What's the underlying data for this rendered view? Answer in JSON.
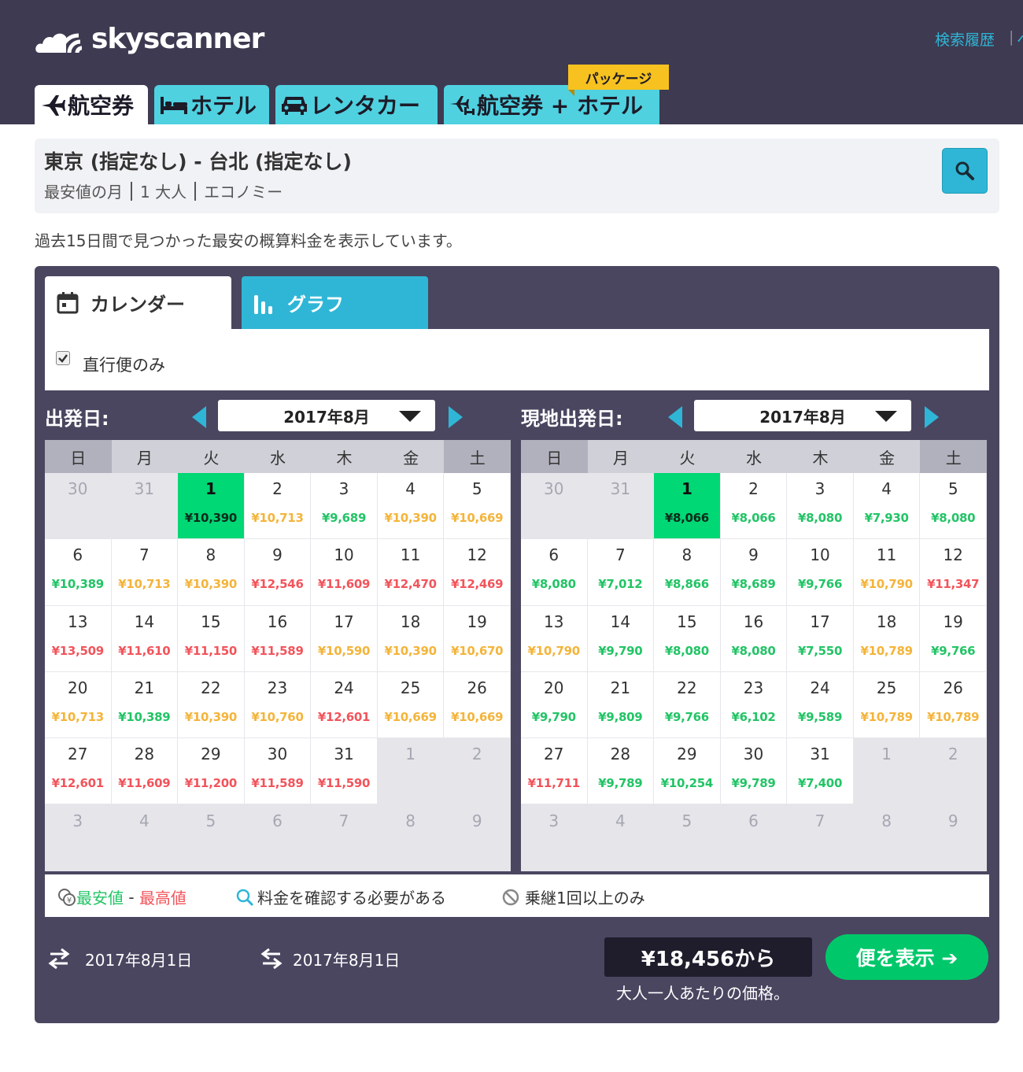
{
  "header": {
    "logo_text": "skyscanner",
    "history_link": "検索履歴",
    "history_sep": "|",
    "history_more": "ヘ",
    "tabs": [
      {
        "label": "航空券",
        "icon": "plane-icon"
      },
      {
        "label": "ホテル",
        "icon": "bed-icon"
      },
      {
        "label": "レンタカー",
        "icon": "car-icon"
      },
      {
        "label": "航空券 + ホテル",
        "icon": "plane-hotel-icon"
      }
    ],
    "package_badge": "パッケージ"
  },
  "summary": {
    "route": "東京 (指定なし) - 台北 (指定なし)",
    "month": "最安値の月",
    "passengers": "1 大人",
    "cabin": "エコノミー"
  },
  "note": "過去15日間で見つかった最安の概算料金を表示しています。",
  "view_tabs": {
    "calendar": "カレンダー",
    "graph": "グラフ"
  },
  "filter": {
    "direct_only": "直行便のみ",
    "checked": true
  },
  "weekdays": [
    "日",
    "月",
    "火",
    "水",
    "木",
    "金",
    "土"
  ],
  "outbound": {
    "label": "出発日:",
    "month": "2017年8月",
    "days": [
      {
        "d": "30",
        "o": true
      },
      {
        "d": "31",
        "o": true
      },
      {
        "d": "1",
        "p": "¥10,390",
        "c": "g",
        "sel": true
      },
      {
        "d": "2",
        "p": "¥10,713",
        "c": "y"
      },
      {
        "d": "3",
        "p": "¥9,689",
        "c": "g"
      },
      {
        "d": "4",
        "p": "¥10,390",
        "c": "y"
      },
      {
        "d": "5",
        "p": "¥10,669",
        "c": "y"
      },
      {
        "d": "6",
        "p": "¥10,389",
        "c": "g"
      },
      {
        "d": "7",
        "p": "¥10,713",
        "c": "y"
      },
      {
        "d": "8",
        "p": "¥10,390",
        "c": "y"
      },
      {
        "d": "9",
        "p": "¥12,546",
        "c": "r"
      },
      {
        "d": "10",
        "p": "¥11,609",
        "c": "r"
      },
      {
        "d": "11",
        "p": "¥12,470",
        "c": "r"
      },
      {
        "d": "12",
        "p": "¥12,469",
        "c": "r"
      },
      {
        "d": "13",
        "p": "¥13,509",
        "c": "r"
      },
      {
        "d": "14",
        "p": "¥11,610",
        "c": "r"
      },
      {
        "d": "15",
        "p": "¥11,150",
        "c": "r"
      },
      {
        "d": "16",
        "p": "¥11,589",
        "c": "r"
      },
      {
        "d": "17",
        "p": "¥10,590",
        "c": "y"
      },
      {
        "d": "18",
        "p": "¥10,390",
        "c": "y"
      },
      {
        "d": "19",
        "p": "¥10,670",
        "c": "y"
      },
      {
        "d": "20",
        "p": "¥10,713",
        "c": "y"
      },
      {
        "d": "21",
        "p": "¥10,389",
        "c": "g"
      },
      {
        "d": "22",
        "p": "¥10,390",
        "c": "y"
      },
      {
        "d": "23",
        "p": "¥10,760",
        "c": "y"
      },
      {
        "d": "24",
        "p": "¥12,601",
        "c": "r"
      },
      {
        "d": "25",
        "p": "¥10,669",
        "c": "y"
      },
      {
        "d": "26",
        "p": "¥10,669",
        "c": "y"
      },
      {
        "d": "27",
        "p": "¥12,601",
        "c": "r"
      },
      {
        "d": "28",
        "p": "¥11,609",
        "c": "r"
      },
      {
        "d": "29",
        "p": "¥11,200",
        "c": "r"
      },
      {
        "d": "30",
        "p": "¥11,589",
        "c": "r"
      },
      {
        "d": "31",
        "p": "¥11,590",
        "c": "r"
      },
      {
        "d": "1",
        "o": true
      },
      {
        "d": "2",
        "o": true
      },
      {
        "d": "3",
        "o": true
      },
      {
        "d": "4",
        "o": true
      },
      {
        "d": "5",
        "o": true
      },
      {
        "d": "6",
        "o": true
      },
      {
        "d": "7",
        "o": true
      },
      {
        "d": "8",
        "o": true
      },
      {
        "d": "9",
        "o": true
      }
    ]
  },
  "return": {
    "label": "現地出発日:",
    "month": "2017年8月",
    "days": [
      {
        "d": "30",
        "o": true
      },
      {
        "d": "31",
        "o": true
      },
      {
        "d": "1",
        "p": "¥8,066",
        "c": "g",
        "sel": true
      },
      {
        "d": "2",
        "p": "¥8,066",
        "c": "g"
      },
      {
        "d": "3",
        "p": "¥8,080",
        "c": "g"
      },
      {
        "d": "4",
        "p": "¥7,930",
        "c": "g"
      },
      {
        "d": "5",
        "p": "¥8,080",
        "c": "g"
      },
      {
        "d": "6",
        "p": "¥8,080",
        "c": "g"
      },
      {
        "d": "7",
        "p": "¥7,012",
        "c": "g"
      },
      {
        "d": "8",
        "p": "¥8,866",
        "c": "g"
      },
      {
        "d": "9",
        "p": "¥8,689",
        "c": "g"
      },
      {
        "d": "10",
        "p": "¥9,766",
        "c": "g"
      },
      {
        "d": "11",
        "p": "¥10,790",
        "c": "y"
      },
      {
        "d": "12",
        "p": "¥11,347",
        "c": "r"
      },
      {
        "d": "13",
        "p": "¥10,790",
        "c": "y"
      },
      {
        "d": "14",
        "p": "¥9,790",
        "c": "g"
      },
      {
        "d": "15",
        "p": "¥8,080",
        "c": "g"
      },
      {
        "d": "16",
        "p": "¥8,080",
        "c": "g"
      },
      {
        "d": "17",
        "p": "¥7,550",
        "c": "g"
      },
      {
        "d": "18",
        "p": "¥10,789",
        "c": "y"
      },
      {
        "d": "19",
        "p": "¥9,766",
        "c": "g"
      },
      {
        "d": "20",
        "p": "¥9,790",
        "c": "g"
      },
      {
        "d": "21",
        "p": "¥9,809",
        "c": "g"
      },
      {
        "d": "22",
        "p": "¥9,766",
        "c": "g"
      },
      {
        "d": "23",
        "p": "¥6,102",
        "c": "g"
      },
      {
        "d": "24",
        "p": "¥9,589",
        "c": "g"
      },
      {
        "d": "25",
        "p": "¥10,789",
        "c": "y"
      },
      {
        "d": "26",
        "p": "¥10,789",
        "c": "y"
      },
      {
        "d": "27",
        "p": "¥11,711",
        "c": "r"
      },
      {
        "d": "28",
        "p": "¥9,789",
        "c": "g"
      },
      {
        "d": "29",
        "p": "¥10,254",
        "c": "g"
      },
      {
        "d": "30",
        "p": "¥9,789",
        "c": "g"
      },
      {
        "d": "31",
        "p": "¥7,400",
        "c": "g"
      },
      {
        "d": "1",
        "o": true
      },
      {
        "d": "2",
        "o": true
      },
      {
        "d": "3",
        "o": true
      },
      {
        "d": "4",
        "o": true
      },
      {
        "d": "5",
        "o": true
      },
      {
        "d": "6",
        "o": true
      },
      {
        "d": "7",
        "o": true
      },
      {
        "d": "8",
        "o": true
      },
      {
        "d": "9",
        "o": true
      }
    ]
  },
  "legend": {
    "cheapest": "最安値",
    "dash": " - ",
    "highest": "最高値",
    "check_price": "料金を確認する必要がある",
    "connecting_only": "乗継1回以上のみ"
  },
  "footer": {
    "depart_date": "2017年8月1日",
    "return_date": "2017年8月1日",
    "price": "¥18,456から",
    "price_note": "大人一人あたりの価格。",
    "show_button": "便を表示 ➔"
  },
  "colors": {
    "header_bg": "#3e3a51",
    "accent": "#2fb6d6",
    "cheap": "#22c466",
    "mid": "#f4b43a",
    "expensive": "#f2545b",
    "selected": "#00d775",
    "cta": "#00c86a"
  }
}
